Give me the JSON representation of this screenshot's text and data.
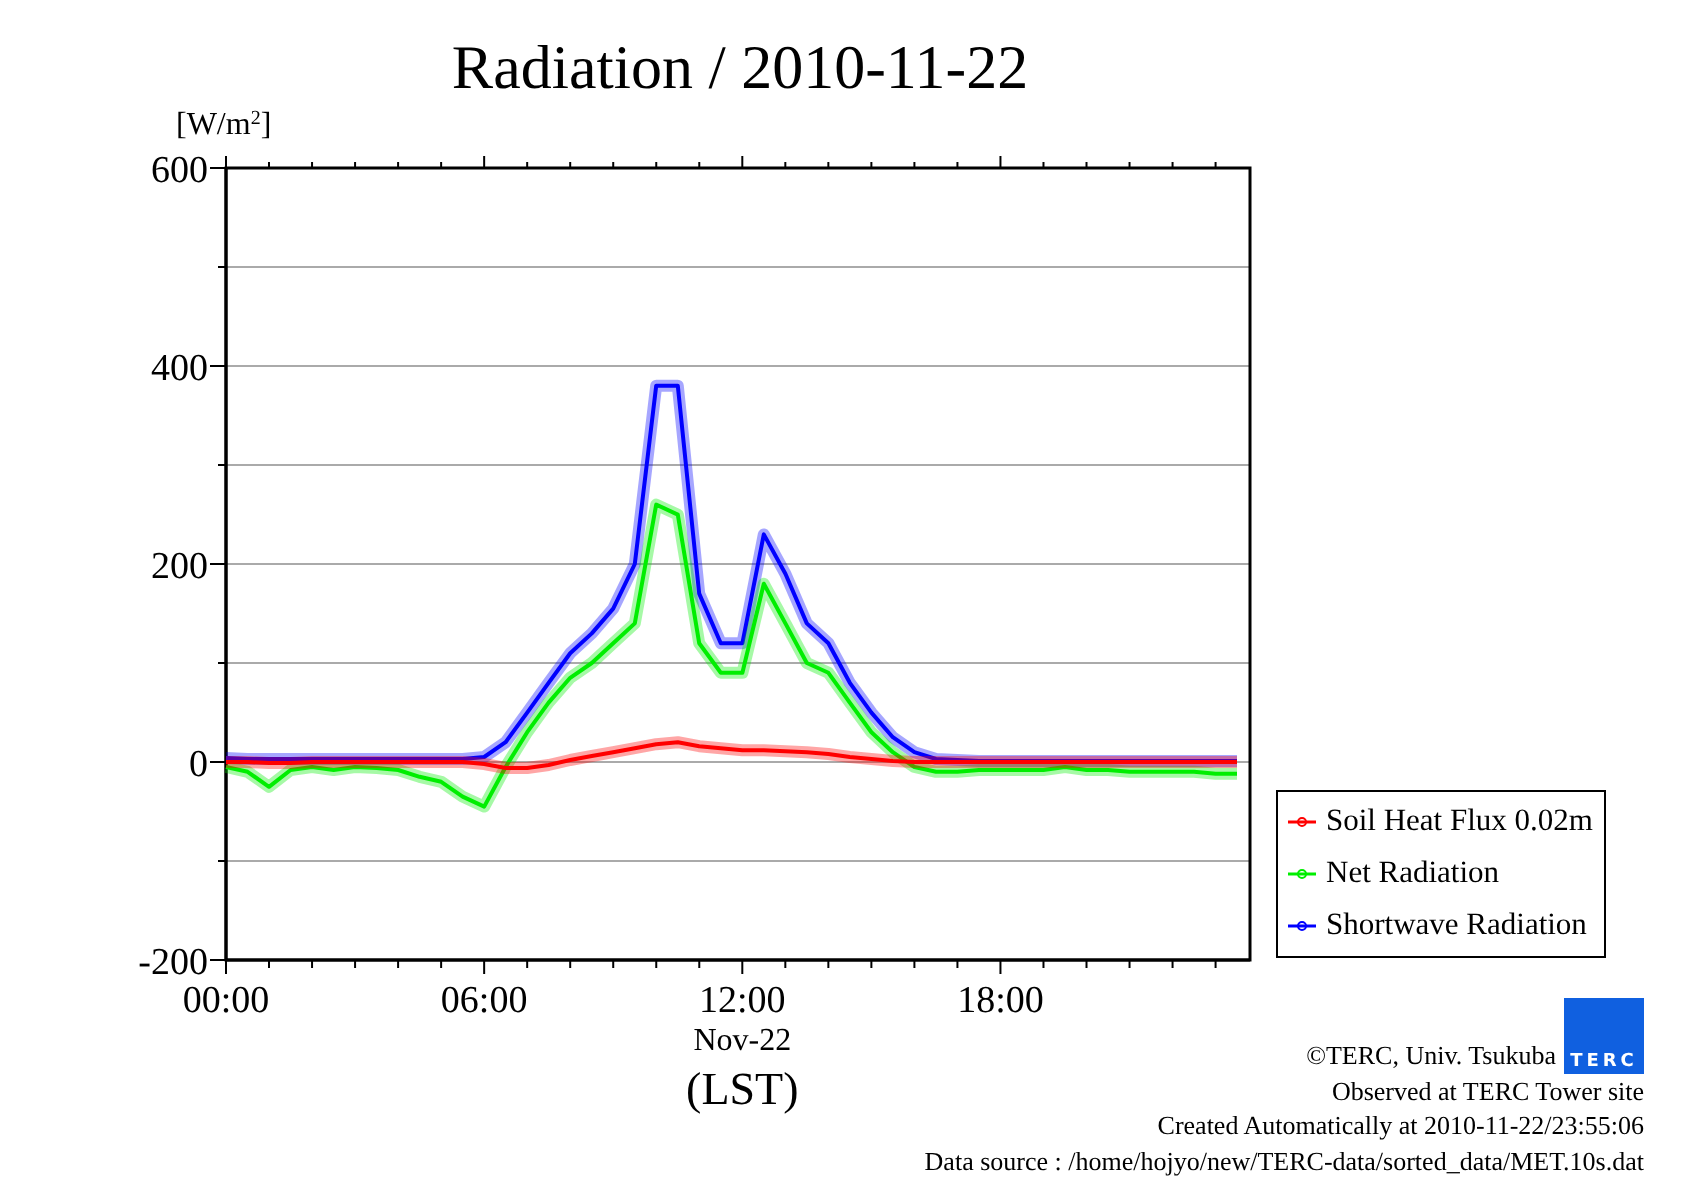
{
  "chart": {
    "chart_data": {
      "type": "line",
      "grid": true,
      "title": "Radiation / 2010-11-22",
      "xlabel": "(LST)",
      "ylabel": "[W/m$^{2}$]",
      "x": [
        0,
        0.5,
        1,
        1.5,
        2,
        2.5,
        3,
        3.5,
        4,
        4.5,
        5,
        5.5,
        6,
        6.5,
        7,
        7.5,
        8,
        8.5,
        9,
        9.5,
        10,
        10.5,
        11,
        11.5,
        12,
        12.5,
        13,
        13.5,
        14,
        14.5,
        15,
        15.5,
        16,
        16.5,
        17,
        17.5,
        18,
        18.5,
        19,
        19.5,
        20,
        20.5,
        21,
        21.5,
        22,
        22.5,
        23,
        23.5
      ],
      "xlim": [
        0,
        23.8
      ],
      "ylim": [
        -200,
        600
      ],
      "xticks": [
        {
          "value": 0,
          "label": "00:00"
        },
        {
          "value": 6,
          "label": "06:00"
        },
        {
          "value": 12,
          "label": "12:00"
        },
        {
          "value": 18,
          "label": "18:00"
        }
      ],
      "yticks": [
        -200,
        0,
        200,
        400,
        600
      ],
      "series": [
        {
          "name": "Soil Heat Flux 0.02m",
          "color": "#ff0000",
          "values": [
            0,
            0,
            -1,
            -1,
            0,
            0,
            0,
            0,
            0,
            0,
            0,
            0,
            -2,
            -6,
            -6,
            -3,
            2,
            6,
            10,
            14,
            18,
            20,
            16,
            14,
            12,
            12,
            11,
            10,
            8,
            5,
            3,
            1,
            0,
            0,
            0,
            0,
            0,
            0,
            0,
            0,
            0,
            0,
            0,
            0,
            0,
            0,
            0,
            0
          ]
        },
        {
          "name": "Net Radiation",
          "color": "#00ee00",
          "values": [
            -5,
            -10,
            -25,
            -8,
            -5,
            -8,
            -5,
            -6,
            -8,
            -15,
            -20,
            -35,
            -45,
            -5,
            30,
            60,
            85,
            100,
            120,
            140,
            260,
            250,
            120,
            90,
            90,
            180,
            140,
            100,
            90,
            60,
            30,
            10,
            -5,
            -10,
            -10,
            -8,
            -8,
            -8,
            -8,
            -5,
            -8,
            -8,
            -10,
            -10,
            -10,
            -10,
            -12,
            -12
          ]
        },
        {
          "name": "Shortwave Radiation",
          "color": "#0000ff",
          "values": [
            4,
            3,
            3,
            3,
            3,
            3,
            3,
            3,
            3,
            3,
            3,
            3,
            5,
            20,
            50,
            80,
            110,
            130,
            155,
            200,
            380,
            380,
            170,
            120,
            120,
            230,
            190,
            140,
            120,
            80,
            50,
            25,
            10,
            3,
            2,
            1,
            1,
            1,
            1,
            1,
            1,
            1,
            1,
            1,
            1,
            1,
            1,
            1
          ]
        }
      ]
    },
    "date_label": "Nov-22"
  },
  "logo_text": "TERC",
  "footer": [
    "©TERC, Univ. Tsukuba",
    "Observed at TERC Tower site",
    "Created Automatically at 2010-11-22/23:55:06",
    "Data source : /home/hojyo/new/TERC-data/sorted_data/MET.10s.dat"
  ]
}
